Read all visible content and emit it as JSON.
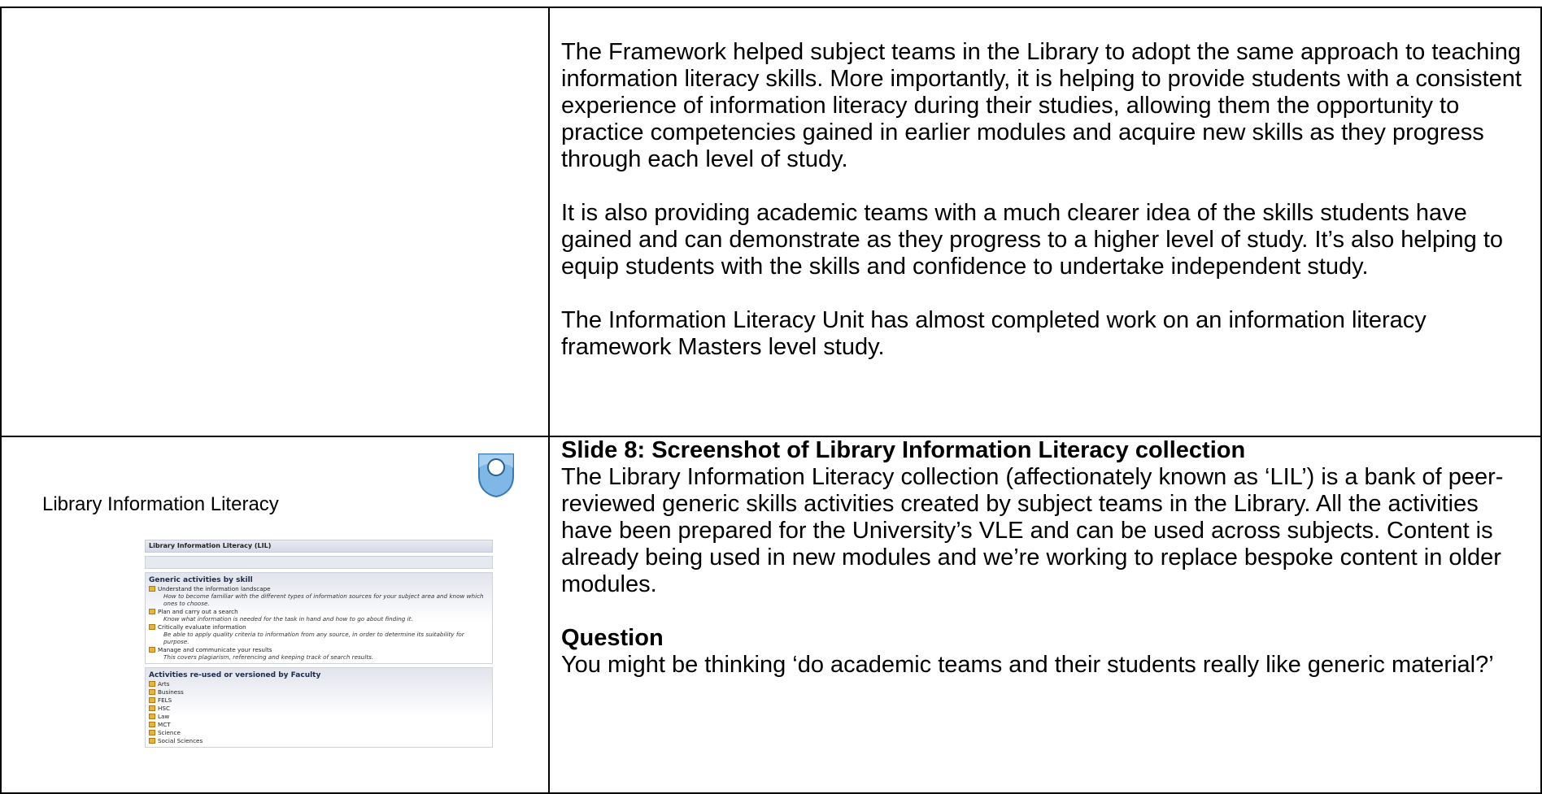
{
  "row1": {
    "paragraphs": [
      "The Framework helped subject teams in the Library to adopt the same approach to teaching information literacy skills.  More importantly, it is helping to provide students with a consistent experience of information literacy during their studies, allowing them the opportunity to practice competencies gained in earlier modules and acquire new skills as they progress through each level of study.",
      "It is also providing academic teams with a much clearer idea of the skills students have gained and can demonstrate as they progress to a higher level of study.  It’s also helping to equip students with the skills and confidence to undertake independent study.",
      "The Information Literacy Unit has almost completed work on an information literacy framework Masters level study."
    ]
  },
  "row2": {
    "slide": {
      "title": "Library Information Literacy",
      "screenshot": {
        "header": "Library Information Literacy (LIL)",
        "skills_heading": "Generic activities by skill",
        "skills": [
          {
            "label": "Understand the information landscape",
            "desc": "How to become familiar with the different types of information sources for your subject area and know which ones to choose."
          },
          {
            "label": "Plan and carry out a search",
            "desc": "Know what information is needed for the task in hand and how to go about finding it."
          },
          {
            "label": "Critically evaluate information",
            "desc": "Be able to apply quality criteria to information from any source, in order to determine its suitability for purpose."
          },
          {
            "label": "Manage and communicate your results",
            "desc": "This covers plagiarism, referencing and keeping track of search results."
          }
        ],
        "faculty_heading": "Activities re-used or versioned by Faculty",
        "faculties": [
          "Arts",
          "Business",
          "FELS",
          "HSC",
          "Law",
          "MCT",
          "Science",
          "Social Sciences"
        ]
      }
    },
    "heading": "Slide 8: Screenshot of Library Information Literacy collection",
    "body": "The Library Information Literacy collection (affectionately known as ‘LIL’) is a bank of peer-reviewed generic skills activities created by subject teams in the Library.  All the activities have been prepared for the University’s VLE and can be used across subjects.  Content is already being used in new modules and we’re working to replace bespoke content in older modules.",
    "question_heading": "Question",
    "question_text": "You might be thinking ‘do academic teams and their students really like generic material?’"
  }
}
